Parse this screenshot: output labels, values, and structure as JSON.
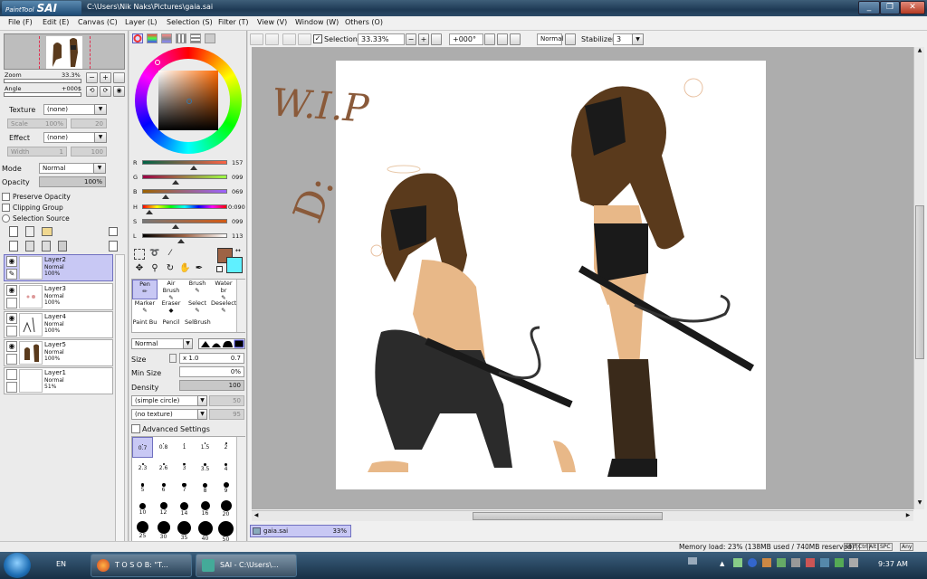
{
  "window": {
    "logo_text": "SAI",
    "logo_small": "PaintTool",
    "title": "C:\\Users\\Nik Naks\\Pictures\\gaia.sai",
    "controls": [
      "_",
      "❐",
      "✕"
    ]
  },
  "menu": [
    "File (F)",
    "Edit (E)",
    "Canvas (C)",
    "Layer (L)",
    "Selection (S)",
    "Filter (T)",
    "View (V)",
    "Window (W)",
    "Others (O)"
  ],
  "navigator": {
    "zoom_label": "Zoom",
    "zoom_value": "33.3%",
    "angle_label": "Angle",
    "angle_value": "+000$"
  },
  "layer_props": {
    "texture_label": "Texture",
    "texture_value": "(none)",
    "scale_label": "Scale",
    "scale_value": "100%",
    "scale_num": "20",
    "effect_label": "Effect",
    "effect_value": "(none)",
    "width_label": "Width",
    "width_num": "1",
    "width_max": "100",
    "mode_label": "Mode",
    "mode_value": "Normal",
    "opacity_label": "Opacity",
    "opacity_value": "100%",
    "preserve_opacity": "Preserve Opacity",
    "clipping_group": "Clipping Group",
    "selection_source": "Selection Source"
  },
  "layers": [
    {
      "name": "Layer2",
      "mode": "Normal",
      "opacity": "100%",
      "selected": true
    },
    {
      "name": "Layer3",
      "mode": "Normal",
      "opacity": "100%",
      "selected": false
    },
    {
      "name": "Layer4",
      "mode": "Normal",
      "opacity": "100%",
      "selected": false
    },
    {
      "name": "Layer5",
      "mode": "Normal",
      "opacity": "100%",
      "selected": false
    },
    {
      "name": "Layer1",
      "mode": "Normal",
      "opacity": "51%",
      "selected": false
    }
  ],
  "color": {
    "r_label": "R",
    "r_value": "157",
    "g_label": "G",
    "g_value": "099",
    "b_label": "B",
    "b_value": "069",
    "h_label": "H",
    "h_value": "0:090",
    "s_label": "S",
    "s_value": "099",
    "l_label": "L",
    "l_value": "113",
    "primary": "#9d6345",
    "secondary": "#5ff0ff"
  },
  "tools": {
    "row1": [
      "Pen",
      "Air Brush",
      "Brush",
      "Water br"
    ],
    "row2": [
      "Marker",
      "Eraser",
      "Select",
      "Deselect"
    ],
    "row3": [
      "Paint Bu",
      "Pencil",
      "SelBrush"
    ]
  },
  "brush": {
    "blend_mode": "Normal",
    "size_label": "Size",
    "size_mult": "x 1.0",
    "size_value": "0.7",
    "min_size_label": "Min Size",
    "min_size_value": "0%",
    "density_label": "Density",
    "density_value": "100",
    "shape": "(simple circle)",
    "shape_num": "50",
    "texture": "(no texture)",
    "texture_num": "95",
    "advanced": "Advanced Settings",
    "sizes": [
      "0.7",
      "0.8",
      "1",
      "1.5",
      "2",
      "2.3",
      "2.6",
      "3",
      "3.5",
      "4",
      "5",
      "6",
      "7",
      "8",
      "9",
      "10",
      "12",
      "14",
      "16",
      "20",
      "25",
      "30",
      "35",
      "40",
      "50"
    ]
  },
  "toolbar": {
    "selection_label": "Selection",
    "zoom_value": "33.33%",
    "angle_value": "+000°",
    "mode_value": "Normal",
    "stabilizer_label": "Stabilizer",
    "stabilizer_value": "3"
  },
  "canvas_tab": {
    "name": "gaia.sai",
    "zoom": "33%"
  },
  "status": {
    "memory": "Memory load: 23% (138MB used / 740MB reserved)",
    "keys": [
      "Shift",
      "Ctrl",
      "Alt",
      "SPC",
      "Any"
    ]
  },
  "taskbar": {
    "lang": "EN",
    "task1": "T O S O B: \"T...",
    "task2": "SAI - C:\\Users\\...",
    "clock": "9:37 AM"
  },
  "artwork": {
    "handwriting": "W.I.P"
  }
}
